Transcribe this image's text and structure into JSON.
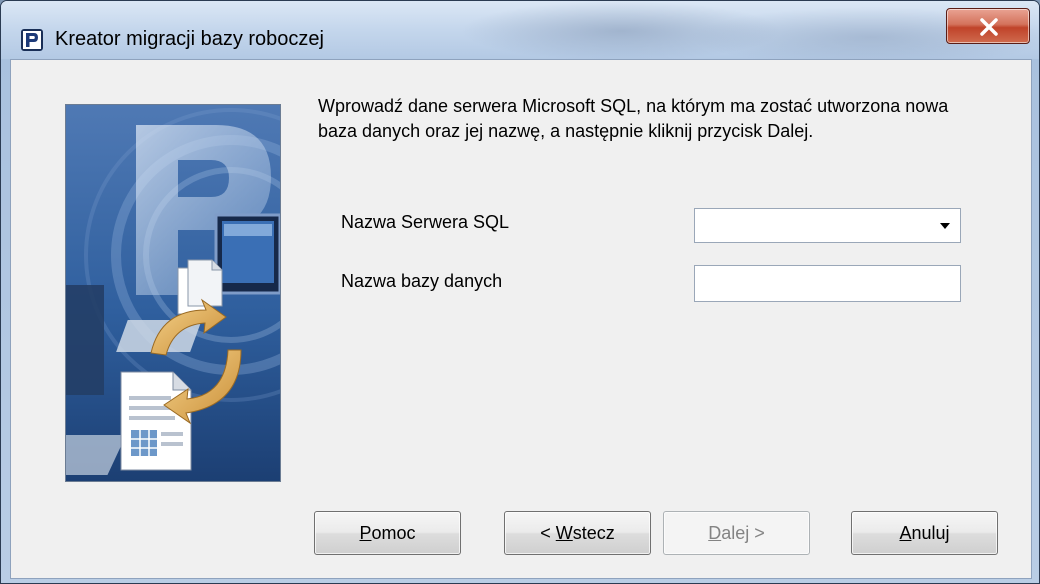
{
  "window": {
    "title": "Kreator migracji bazy roboczej",
    "close_label": "X"
  },
  "intro": {
    "text": "Wprowadź dane serwera Microsoft SQL, na którym ma zostać utworzona nowa baza danych oraz jej nazwę, a następnie kliknij przycisk Dalej."
  },
  "form": {
    "server_label": "Nazwa Serwera SQL",
    "server_value": "",
    "database_label": "Nazwa bazy danych",
    "database_value": ""
  },
  "buttons": {
    "help": {
      "label_accel": "P",
      "label_rest": "omoc",
      "enabled": true
    },
    "back": {
      "label_pre": "< ",
      "label_accel": "W",
      "label_rest": "stecz",
      "enabled": true
    },
    "next": {
      "label_accel": "D",
      "label_rest": "alej >",
      "enabled": false
    },
    "cancel": {
      "label_accel": "A",
      "label_rest": "nuluj",
      "enabled": true
    }
  },
  "icons": {
    "app": "app-logo-icon",
    "close": "close-icon",
    "dropdown": "chevron-down-icon",
    "wizard": "wizard-illustration"
  },
  "colors": {
    "accent": "#3c7fb1",
    "close": "#c0432a",
    "illustration": "#2f5f9e"
  }
}
